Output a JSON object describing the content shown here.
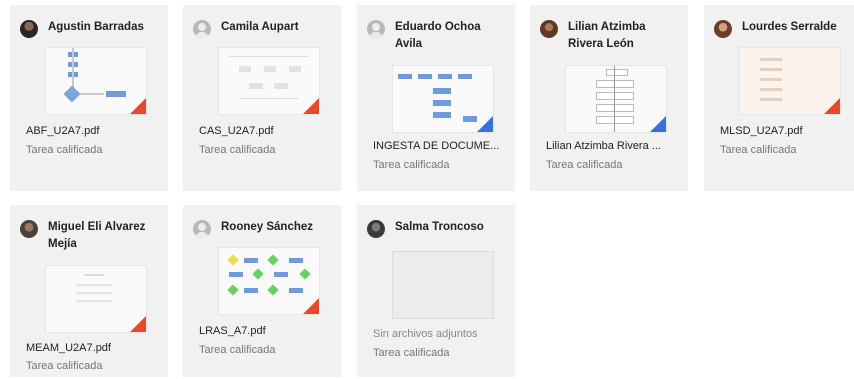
{
  "cards": [
    {
      "name": "Agustin Barradas",
      "file": "ABF_U2A7.pdf",
      "status": "Tarea calificada"
    },
    {
      "name": "Camila Aupart",
      "file": "CAS_U2A7.pdf",
      "status": "Tarea calificada"
    },
    {
      "name": "Eduardo Ochoa Avila",
      "file": "INGESTA DE DOCUME...",
      "status": "Tarea calificada"
    },
    {
      "name": "Lilian Atzimba Rivera León",
      "file": "Lilian Atzimba Rivera ...",
      "status": "Tarea calificada"
    },
    {
      "name": "Lourdes Serralde",
      "file": "MLSD_U2A7.pdf",
      "status": "Tarea calificada"
    },
    {
      "name": "Miguel Eli Alvarez Mejía",
      "file": "MEAM_U2A7.pdf",
      "status": "Tarea calificada"
    },
    {
      "name": "Rooney Sánchez",
      "file": "LRAS_A7.pdf",
      "status": "Tarea calificada"
    },
    {
      "name": "Salma Troncoso",
      "no_attachments": "Sin archivos adjuntos",
      "status": "Tarea calificada"
    }
  ],
  "icons": {
    "generic_avatar": "person-placeholder-icon",
    "pdf_badge": "pdf-corner-icon"
  },
  "colors": {
    "card_bg": "#f1f1f1",
    "pdf_red": "#e8482c",
    "doc_blue": "#3a6fe0"
  }
}
